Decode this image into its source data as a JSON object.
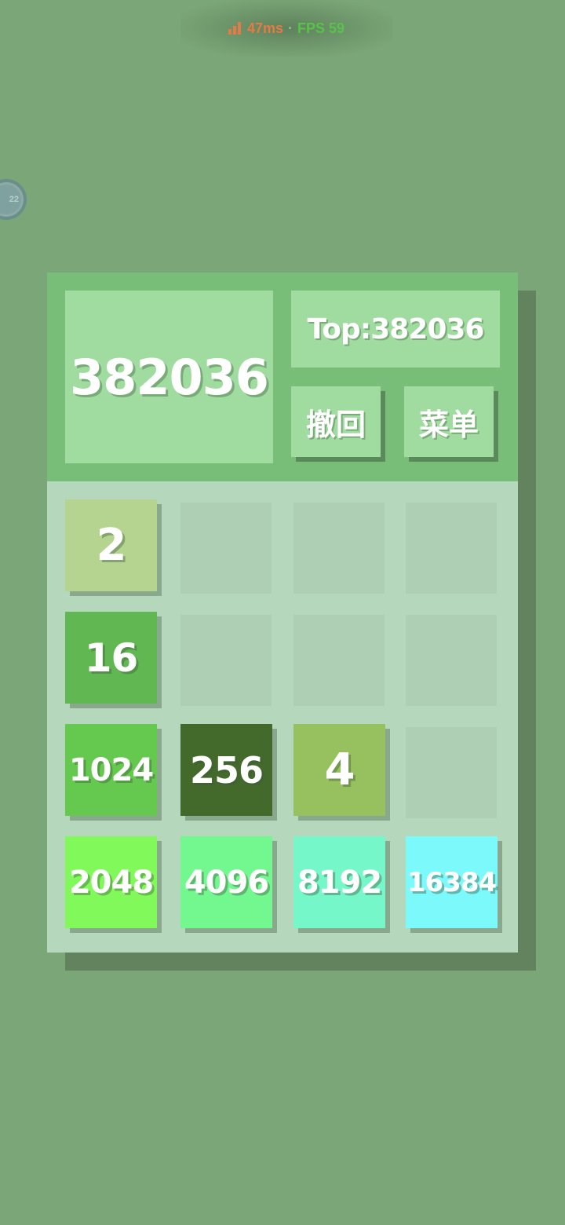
{
  "status_overlay": {
    "latency": "47ms",
    "separator": "·",
    "fps": "FPS 59"
  },
  "side_bubble": {
    "text": "22"
  },
  "header": {
    "score": "382036",
    "top_score": "Top:382036",
    "undo_label": "撤回",
    "menu_label": "菜单"
  },
  "board": {
    "rows": [
      [
        "2",
        "",
        "",
        ""
      ],
      [
        "16",
        "",
        "",
        ""
      ],
      [
        "1024",
        "256",
        "4",
        ""
      ],
      [
        "2048",
        "4096",
        "8192",
        "16384"
      ]
    ]
  },
  "colors": {
    "background": "#7ba677",
    "header": "#78bd78",
    "header_box": "#a0dca0",
    "grid": "#b5d8bc",
    "empty_cell": "#afcfb4",
    "tile_2": "#b5d48f",
    "tile_4": "#97c05e",
    "tile_16": "#61b751",
    "tile_256": "#436a2a",
    "tile_1024": "#66c94f",
    "tile_2048": "#82f95a",
    "tile_4096": "#73f78f",
    "tile_8192": "#75f7c9",
    "tile_16384": "#7bf9fb"
  }
}
